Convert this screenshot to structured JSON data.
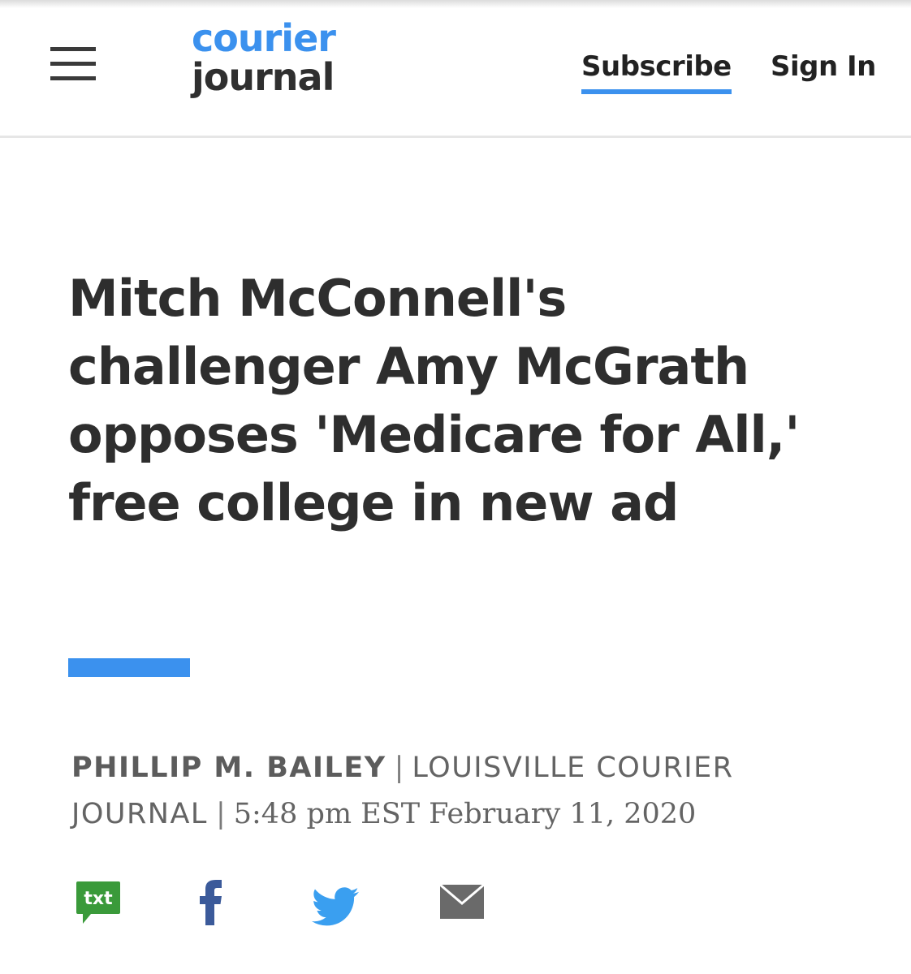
{
  "header": {
    "logo_line1": "courier",
    "logo_line2": "journal",
    "subscribe_label": "Subscribe",
    "signin_label": "Sign In"
  },
  "article": {
    "headline": "Mitch McConnell's challenger Amy McGrath opposes 'Medicare for All,' free college in new ad",
    "author": "PHILLIP M. BAILEY",
    "outlet": "LOUISVILLE COURIER JOURNAL",
    "timestamp": "5:48 pm EST February 11, 2020"
  },
  "share": {
    "txt_label": "txt",
    "icons": [
      "sms-icon",
      "facebook-icon",
      "twitter-icon",
      "email-icon"
    ]
  },
  "colors": {
    "accent": "#3b91ee",
    "sms_green": "#3a9a3a",
    "facebook_blue": "#3b5a9a",
    "twitter_blue": "#3a9ff0",
    "mail_gray": "#6a6a6a",
    "text_dark": "#2e2e2e",
    "text_gray": "#646464"
  }
}
